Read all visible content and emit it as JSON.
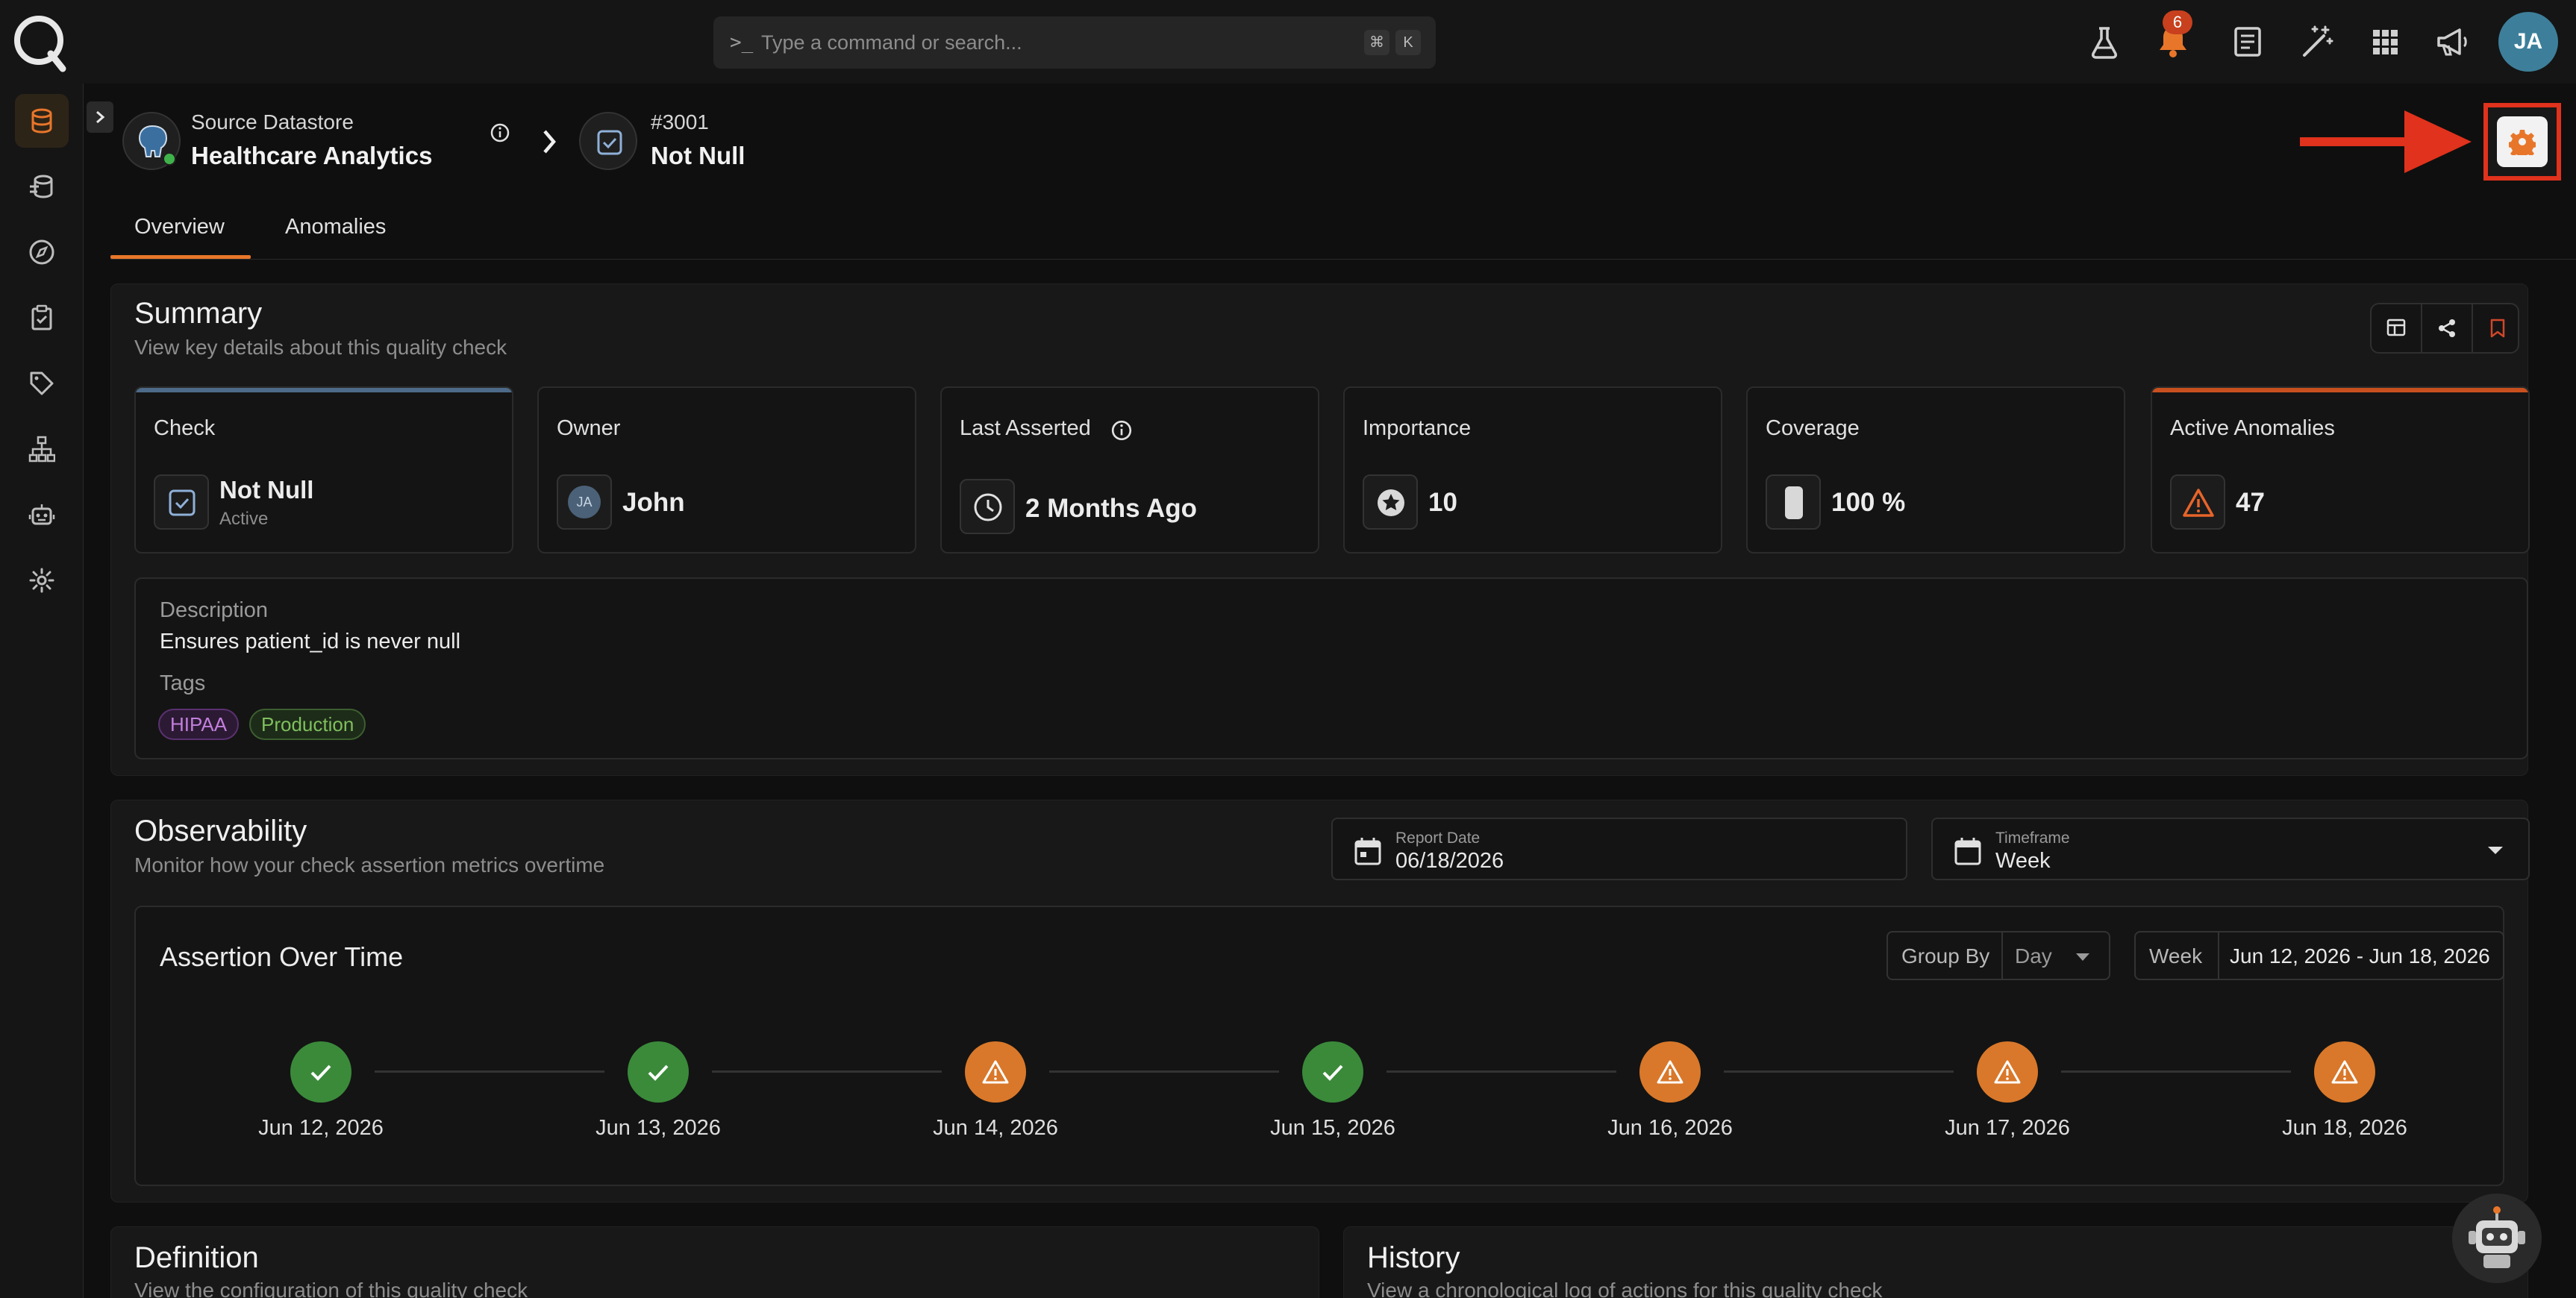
{
  "topbar": {
    "command_placeholder": "Type a command or search...",
    "prompt_symbol": ">_",
    "shortcut_key_1": "⌘",
    "shortcut_key_2": "K",
    "notification_count": "6",
    "user_initials": "JA"
  },
  "header": {
    "datastore_label": "Source Datastore",
    "datastore_name": "Healthcare Analytics",
    "check_number": "#3001",
    "check_name": "Not Null"
  },
  "tabs": [
    {
      "label": "Overview",
      "active": true
    },
    {
      "label": "Anomalies",
      "active": false
    }
  ],
  "summary": {
    "title": "Summary",
    "subtitle": "View key details about this quality check",
    "cards": {
      "check": {
        "label": "Check",
        "value": "Not Null",
        "status": "Active"
      },
      "owner": {
        "label": "Owner",
        "value": "John",
        "initials": "JA"
      },
      "last_asserted": {
        "label": "Last Asserted",
        "value": "2 Months Ago"
      },
      "importance": {
        "label": "Importance",
        "value": "10"
      },
      "coverage": {
        "label": "Coverage",
        "value": "100 %"
      },
      "active_anomalies": {
        "label": "Active Anomalies",
        "value": "47"
      }
    },
    "description_label": "Description",
    "description": "Ensures patient_id is never null",
    "tags_label": "Tags",
    "tags": [
      {
        "label": "HIPAA",
        "color": "#b86ad0"
      },
      {
        "label": "Production",
        "color": "#6fb04f"
      }
    ]
  },
  "observability": {
    "title": "Observability",
    "subtitle": "Monitor how your check assertion metrics overtime",
    "report_date_label": "Report Date",
    "report_date": "06/18/2026",
    "timeframe_label": "Timeframe",
    "timeframe": "Week",
    "chart_title": "Assertion Over Time",
    "group_by_label": "Group By",
    "group_by_value": "Day",
    "range_label": "Week",
    "range_value": "Jun 12, 2026 - Jun 18, 2026",
    "timeline": [
      {
        "date": "Jun 12, 2026",
        "status": "passed"
      },
      {
        "date": "Jun 13, 2026",
        "status": "passed"
      },
      {
        "date": "Jun 14, 2026",
        "status": "anomaly"
      },
      {
        "date": "Jun 15, 2026",
        "status": "passed"
      },
      {
        "date": "Jun 16, 2026",
        "status": "anomaly"
      },
      {
        "date": "Jun 17, 2026",
        "status": "anomaly"
      },
      {
        "date": "Jun 18, 2026",
        "status": "anomaly"
      }
    ]
  },
  "definition": {
    "title": "Definition",
    "subtitle": "View the configuration of this quality check"
  },
  "history": {
    "title": "History",
    "subtitle": "View a chronological log of actions for this quality check"
  },
  "colors": {
    "accent": "#e8762a",
    "ok": "#3a8a3a",
    "warn": "#d9782a",
    "highlight": "#e0321c"
  }
}
